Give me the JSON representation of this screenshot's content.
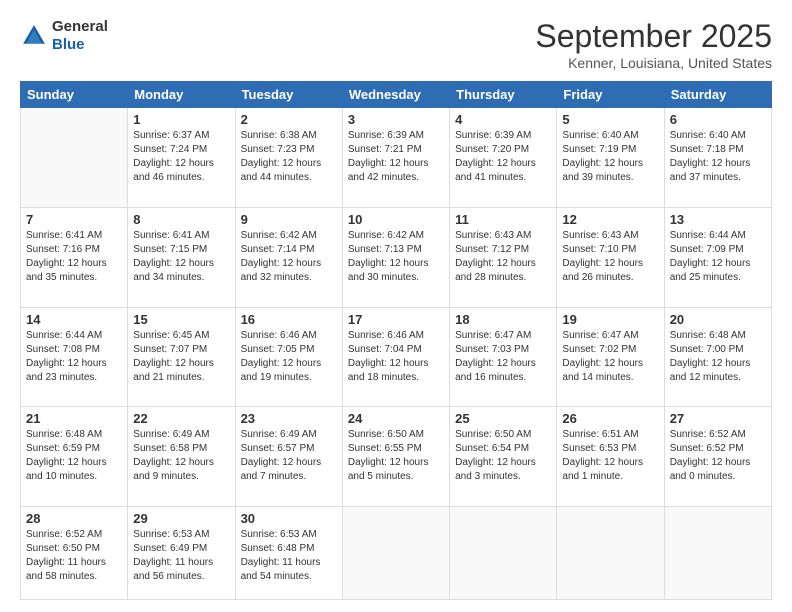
{
  "logo": {
    "line1": "General",
    "line2": "Blue"
  },
  "header": {
    "month": "September 2025",
    "location": "Kenner, Louisiana, United States"
  },
  "weekdays": [
    "Sunday",
    "Monday",
    "Tuesday",
    "Wednesday",
    "Thursday",
    "Friday",
    "Saturday"
  ],
  "weeks": [
    [
      {
        "day": "",
        "info": ""
      },
      {
        "day": "1",
        "info": "Sunrise: 6:37 AM\nSunset: 7:24 PM\nDaylight: 12 hours\nand 46 minutes."
      },
      {
        "day": "2",
        "info": "Sunrise: 6:38 AM\nSunset: 7:23 PM\nDaylight: 12 hours\nand 44 minutes."
      },
      {
        "day": "3",
        "info": "Sunrise: 6:39 AM\nSunset: 7:21 PM\nDaylight: 12 hours\nand 42 minutes."
      },
      {
        "day": "4",
        "info": "Sunrise: 6:39 AM\nSunset: 7:20 PM\nDaylight: 12 hours\nand 41 minutes."
      },
      {
        "day": "5",
        "info": "Sunrise: 6:40 AM\nSunset: 7:19 PM\nDaylight: 12 hours\nand 39 minutes."
      },
      {
        "day": "6",
        "info": "Sunrise: 6:40 AM\nSunset: 7:18 PM\nDaylight: 12 hours\nand 37 minutes."
      }
    ],
    [
      {
        "day": "7",
        "info": "Sunrise: 6:41 AM\nSunset: 7:16 PM\nDaylight: 12 hours\nand 35 minutes."
      },
      {
        "day": "8",
        "info": "Sunrise: 6:41 AM\nSunset: 7:15 PM\nDaylight: 12 hours\nand 34 minutes."
      },
      {
        "day": "9",
        "info": "Sunrise: 6:42 AM\nSunset: 7:14 PM\nDaylight: 12 hours\nand 32 minutes."
      },
      {
        "day": "10",
        "info": "Sunrise: 6:42 AM\nSunset: 7:13 PM\nDaylight: 12 hours\nand 30 minutes."
      },
      {
        "day": "11",
        "info": "Sunrise: 6:43 AM\nSunset: 7:12 PM\nDaylight: 12 hours\nand 28 minutes."
      },
      {
        "day": "12",
        "info": "Sunrise: 6:43 AM\nSunset: 7:10 PM\nDaylight: 12 hours\nand 26 minutes."
      },
      {
        "day": "13",
        "info": "Sunrise: 6:44 AM\nSunset: 7:09 PM\nDaylight: 12 hours\nand 25 minutes."
      }
    ],
    [
      {
        "day": "14",
        "info": "Sunrise: 6:44 AM\nSunset: 7:08 PM\nDaylight: 12 hours\nand 23 minutes."
      },
      {
        "day": "15",
        "info": "Sunrise: 6:45 AM\nSunset: 7:07 PM\nDaylight: 12 hours\nand 21 minutes."
      },
      {
        "day": "16",
        "info": "Sunrise: 6:46 AM\nSunset: 7:05 PM\nDaylight: 12 hours\nand 19 minutes."
      },
      {
        "day": "17",
        "info": "Sunrise: 6:46 AM\nSunset: 7:04 PM\nDaylight: 12 hours\nand 18 minutes."
      },
      {
        "day": "18",
        "info": "Sunrise: 6:47 AM\nSunset: 7:03 PM\nDaylight: 12 hours\nand 16 minutes."
      },
      {
        "day": "19",
        "info": "Sunrise: 6:47 AM\nSunset: 7:02 PM\nDaylight: 12 hours\nand 14 minutes."
      },
      {
        "day": "20",
        "info": "Sunrise: 6:48 AM\nSunset: 7:00 PM\nDaylight: 12 hours\nand 12 minutes."
      }
    ],
    [
      {
        "day": "21",
        "info": "Sunrise: 6:48 AM\nSunset: 6:59 PM\nDaylight: 12 hours\nand 10 minutes."
      },
      {
        "day": "22",
        "info": "Sunrise: 6:49 AM\nSunset: 6:58 PM\nDaylight: 12 hours\nand 9 minutes."
      },
      {
        "day": "23",
        "info": "Sunrise: 6:49 AM\nSunset: 6:57 PM\nDaylight: 12 hours\nand 7 minutes."
      },
      {
        "day": "24",
        "info": "Sunrise: 6:50 AM\nSunset: 6:55 PM\nDaylight: 12 hours\nand 5 minutes."
      },
      {
        "day": "25",
        "info": "Sunrise: 6:50 AM\nSunset: 6:54 PM\nDaylight: 12 hours\nand 3 minutes."
      },
      {
        "day": "26",
        "info": "Sunrise: 6:51 AM\nSunset: 6:53 PM\nDaylight: 12 hours\nand 1 minute."
      },
      {
        "day": "27",
        "info": "Sunrise: 6:52 AM\nSunset: 6:52 PM\nDaylight: 12 hours\nand 0 minutes."
      }
    ],
    [
      {
        "day": "28",
        "info": "Sunrise: 6:52 AM\nSunset: 6:50 PM\nDaylight: 11 hours\nand 58 minutes."
      },
      {
        "day": "29",
        "info": "Sunrise: 6:53 AM\nSunset: 6:49 PM\nDaylight: 11 hours\nand 56 minutes."
      },
      {
        "day": "30",
        "info": "Sunrise: 6:53 AM\nSunset: 6:48 PM\nDaylight: 11 hours\nand 54 minutes."
      },
      {
        "day": "",
        "info": ""
      },
      {
        "day": "",
        "info": ""
      },
      {
        "day": "",
        "info": ""
      },
      {
        "day": "",
        "info": ""
      }
    ]
  ]
}
